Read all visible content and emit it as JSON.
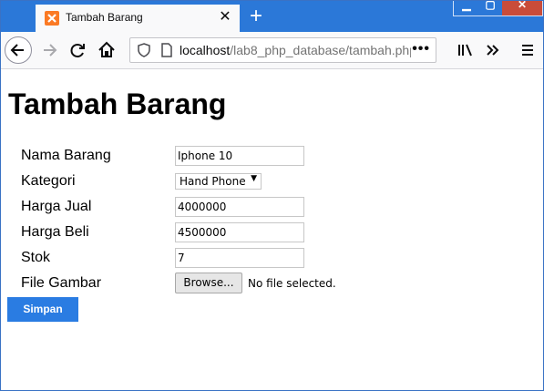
{
  "browser": {
    "tab_title": "Tambah Barang",
    "tab_close": "✕",
    "new_tab": "+",
    "url_host": "localhost",
    "url_path": "/lab8_php_database/tambah.php",
    "url_more": "•••",
    "window_controls": {
      "minimize": "▁",
      "maximize": "▢",
      "close": "✕"
    }
  },
  "page": {
    "title": "Tambah Barang"
  },
  "form": {
    "fields": [
      {
        "label": "Nama Barang",
        "value": "Iphone 10"
      },
      {
        "label": "Kategori",
        "value": "Hand Phone"
      },
      {
        "label": "Harga Jual",
        "value": "4000000"
      },
      {
        "label": "Harga Beli",
        "value": "4500000"
      },
      {
        "label": "Stok",
        "value": "7"
      },
      {
        "label": "File Gambar",
        "value": ""
      }
    ],
    "browse_label": "Browse...",
    "file_status": "No file selected.",
    "submit_label": "Simpan"
  },
  "colors": {
    "titlebar": "#2b78d8",
    "favicon": "#fb7a24",
    "submit": "#2a7ce2"
  }
}
